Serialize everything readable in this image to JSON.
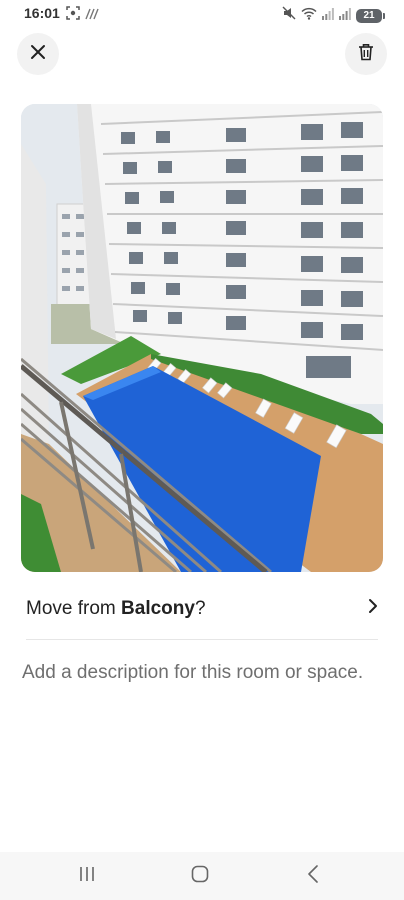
{
  "status_bar": {
    "time": "16:01",
    "battery_level": "21",
    "left_icons": [
      "screenshot-icon",
      "nfc-icon"
    ],
    "right_icons": [
      "mute-icon",
      "wifi-icon",
      "signal-icon",
      "signal-icon",
      "battery-icon"
    ]
  },
  "header": {
    "close_icon": "close-icon",
    "delete_icon": "trash-icon"
  },
  "photo": {
    "subject": "room-photo"
  },
  "move_row": {
    "prefix": "Move from ",
    "room_name": "Balcony",
    "suffix": "?",
    "chevron_icon": "chevron-right-icon"
  },
  "description": {
    "placeholder": "Add a description for this room or space."
  },
  "nav_bar": {
    "icons": [
      "recents-icon",
      "home-icon",
      "back-icon"
    ]
  },
  "colors": {
    "text_primary": "#222222",
    "text_secondary": "#6f6f6f",
    "button_bg": "#f2f2f2",
    "pool_blue": "#1f63d6"
  }
}
